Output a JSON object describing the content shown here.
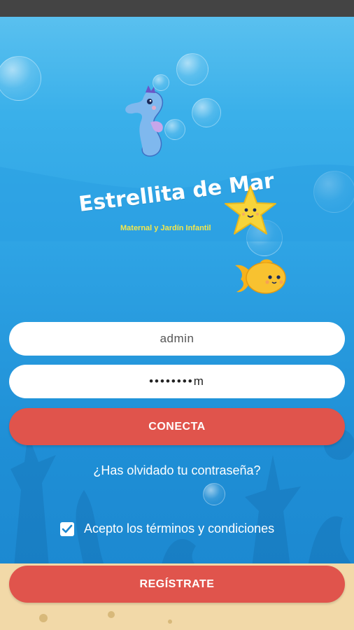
{
  "logo": {
    "title": "Estrellita de Mar",
    "subtitle": "Maternal y Jardín Infantil"
  },
  "login": {
    "username_value": "admin",
    "password_value": "••••••••m",
    "connect_label": "CONECTA",
    "forgot_label": "¿Has olvidado tu contraseña?"
  },
  "terms": {
    "label": "Acepto los términos y condiciones",
    "checked": true
  },
  "register": {
    "label": "REGÍSTRATE"
  },
  "colors": {
    "accent_button": "#e0544c",
    "ocean": "#2ea3e4",
    "sand": "#f2d9a8",
    "subtitle_yellow": "#f5e84a"
  },
  "icons": [
    "seahorse-icon",
    "starfish-icon",
    "fish-icon",
    "checkbox-checked-icon"
  ]
}
